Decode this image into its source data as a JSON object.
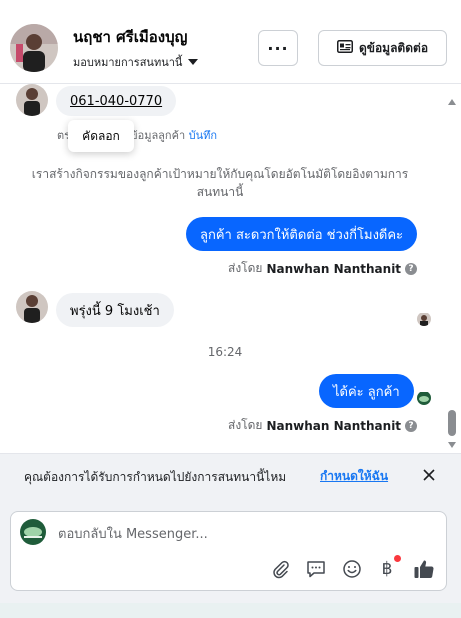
{
  "header": {
    "name": "นฤชา ศรีเมืองบุญ",
    "assign_label": "มอบหมายการสนทนานี้",
    "more_label": "···",
    "contact_button_label": "ดูข้อมูลติดต่อ"
  },
  "conversation": {
    "phone_message": "061-040-0770",
    "copy_tooltip": "คัดลอก",
    "note_prefix": "ตร",
    "note_text": "ข้อมูลลูกค้า",
    "note_link": "บันทึก",
    "system_message": "เราสร้างกิจกรรมของลูกค้าเป้าหมายให้กับคุณโดยอัตโนมัติโดยอิงตามการสนทนานี้",
    "outgoing_1": "ลูกค้า สะดวกให้ติดต่อ ช่วงกี่โมงดีคะ",
    "sent_by_prefix_1": "ส่งโดย",
    "sent_by_name_1": "Nanwhan Nanthanit",
    "incoming_1": "พรุ่งนี้ 9 โมงเช้า",
    "timestamp": "16:24",
    "outgoing_2": "ได้ค่ะ ลูกค้า",
    "sent_by_prefix_2": "ส่งโดย",
    "sent_by_name_2": "Nanwhan Nanthanit"
  },
  "banner": {
    "text": "คุณต้องการได้รับการกำหนดไปยังการสนทนานี้ไหม",
    "link": "กำหนดให้ฉัน"
  },
  "composer": {
    "placeholder": "ตอบกลับใน Messenger...",
    "baht_symbol": "฿"
  },
  "icons": {
    "more": "ellipsis-icon",
    "contact": "contact-card-icon",
    "close": "close-icon",
    "attach": "paperclip-icon",
    "saved_reply": "speech-bubble-icon",
    "emoji": "smiley-icon",
    "payment": "baht-icon",
    "like": "thumbs-up-icon"
  },
  "colors": {
    "brand_blue": "#0866ff",
    "link_blue": "#1877f2",
    "incoming_bubble": "#f0f2f5",
    "notification_dot": "#fa383e"
  }
}
